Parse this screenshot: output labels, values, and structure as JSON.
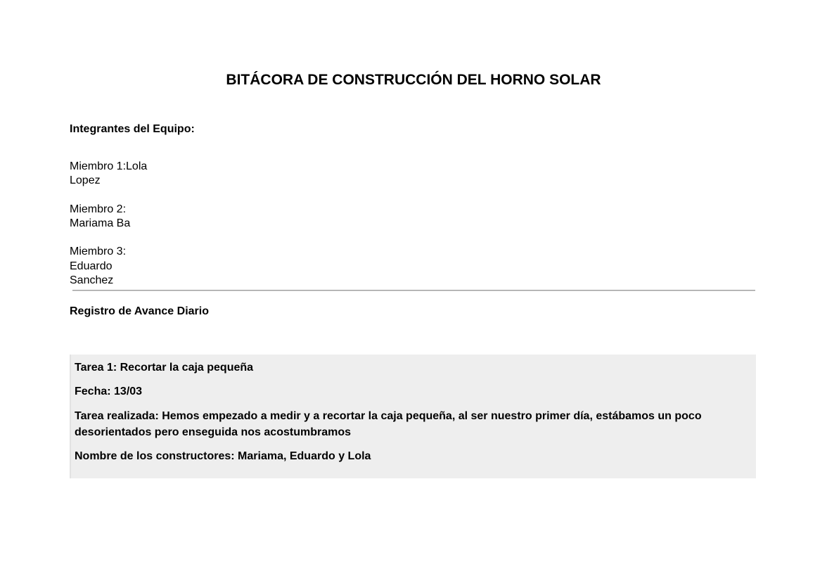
{
  "document": {
    "title": "BITÁCORA DE CONSTRUCCIÓN DEL HORNO SOLAR",
    "team": {
      "heading": "Integrantes del Equipo:",
      "members": [
        "Miembro 1:Lola\nLopez",
        "Miembro 2:\nMariama Ba",
        "Miembro 3:\nEduardo\nSanchez"
      ]
    },
    "log": {
      "heading": "Registro de Avance Diario",
      "tasks": [
        {
          "title": "Tarea 1: Recortar la caja pequeña",
          "date": "Fecha: 13/03",
          "done": "Tarea realizada: Hemos empezado a medir y a recortar la caja pequeña, al ser nuestro primer día, estábamos un poco desorientados pero enseguida nos acostumbramos",
          "builders": "Nombre de los constructores: Mariama, Eduardo y Lola"
        }
      ]
    }
  }
}
